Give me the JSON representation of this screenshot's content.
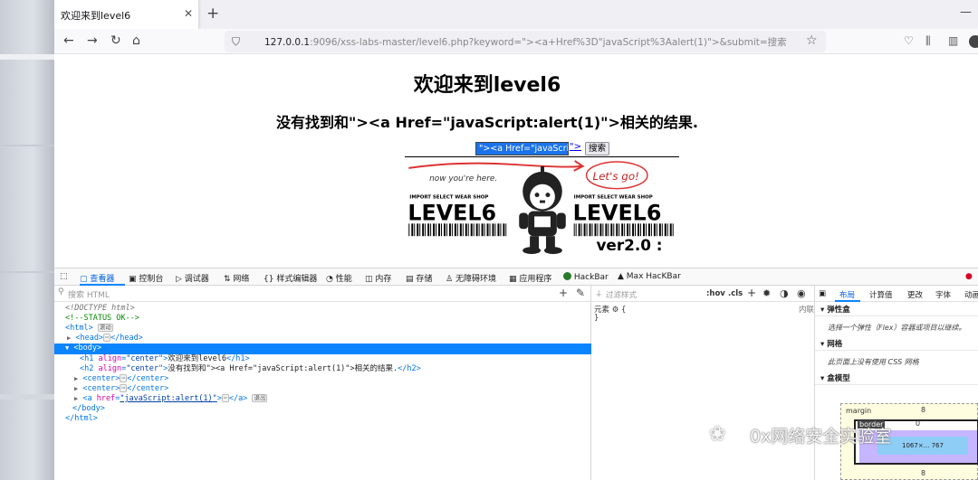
{
  "browser": {
    "tab_title": "欢迎来到level6",
    "tab_close": "✕",
    "new_tab": "+",
    "minimize": "—",
    "url_host": "127.0.0.1",
    "url_rest": ":9096/xss-labs-master/level6.php?keyword=\"><a+Href%3D\"javaScript%3Aalert(1)\">&submit=搜索"
  },
  "page": {
    "title": "欢迎来到level6",
    "subtitle": "没有找到和\"><a Href=\"javaScript:alert(1)\">相关的结果.",
    "input_value": "\"><a Href=\"javaScript:",
    "input_link": "\">",
    "search_button": "搜索",
    "image": {
      "scribble": "now you're here.",
      "bubble": "Let's go!",
      "shop_left": "IMPORT SELECT WEAR SHOP",
      "shop_right": "IMPORT SELECT WEAR SHOP",
      "level_left": "LEVEL6",
      "level_right": "LEVEL6",
      "version": "ver2.0 :"
    }
  },
  "devtools": {
    "tabs": [
      "查看器",
      "控制台",
      "调试器",
      "网络",
      "样式编辑器",
      "性能",
      "内存",
      "存储",
      "无障碍环境",
      "应用程序",
      "HackBar",
      "Max HacKBar"
    ],
    "search_placeholder": "搜索 HTML",
    "tree": {
      "doctype": "<!DOCTYPE html>",
      "comment": "<!--STATUS OK-->",
      "html_open": "<html>",
      "html_badge": "滚动",
      "head": "<head>",
      "head_close": "</head>",
      "body_open": "<body>",
      "h1_attr_name": "align",
      "h1_attr_val": "\"center\"",
      "h1_text": "欢迎来到level6",
      "h2_attr_val": "\"center\"",
      "h2_text": "没有找到和\"><a Href=\"javaScript:alert(1)\">相关的结果.",
      "center": "<center>",
      "center_close": "</center>",
      "a_attr_name": "href",
      "a_attr_val": "\"javaScript:alert(1)\"",
      "a_close": "</a>",
      "a_badge": "退出",
      "body_close": "</body>",
      "html_close": "</html>",
      "ellipsis": "⋯"
    },
    "rules": {
      "filter_placeholder": "过滤样式",
      "hov": ":hov",
      "cls": ".cls",
      "element": "元素",
      "brace_open": "{",
      "brace_close": "}",
      "inline": "内联"
    },
    "layout": {
      "tabs": [
        "布局",
        "计算值",
        "更改",
        "字体",
        "动画"
      ],
      "flex_header": "弹性盒",
      "flex_body": "选择一个弹性（Flex）容器或项目以继续。",
      "grid_header": "网格",
      "grid_body": "此页面上没有使用 CSS 网格",
      "box_header": "盒模型",
      "margin_label": "margin",
      "border_label": "border",
      "margin_value": "8",
      "border_value": "0",
      "padding_label": "padding",
      "content_label": "1067×... 767"
    }
  },
  "watermark": "0x网络安全实验室"
}
